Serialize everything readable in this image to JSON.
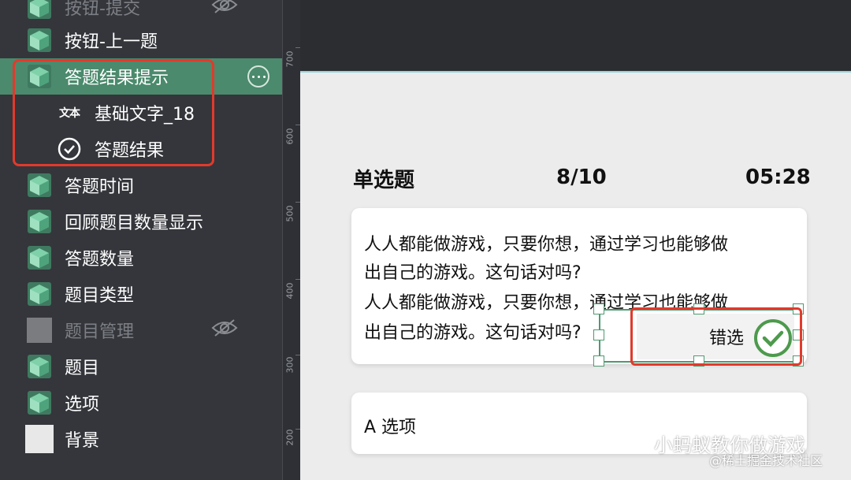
{
  "layers": [
    {
      "label": "按钮-提交",
      "icon": "cube-icon",
      "hidden": true
    },
    {
      "label": "按钮-上一题",
      "icon": "cube-icon",
      "hidden": false
    },
    {
      "label": "答题结果提示",
      "icon": "cube-icon",
      "hidden": false,
      "selected": true
    },
    {
      "label": "基础文字_18",
      "icon": "text-type-icon",
      "icon_text": "文本",
      "child": true
    },
    {
      "label": "答题结果",
      "icon": "check-circle-icon",
      "child": true
    },
    {
      "label": "答题时间",
      "icon": "cube-icon"
    },
    {
      "label": "回顾题目数量显示",
      "icon": "cube-icon"
    },
    {
      "label": "答题数量",
      "icon": "cube-icon"
    },
    {
      "label": "题目类型",
      "icon": "cube-icon"
    },
    {
      "label": "题目管理",
      "icon": "gray-square-icon",
      "hidden": true
    },
    {
      "label": "题目",
      "icon": "cube-icon"
    },
    {
      "label": "选项",
      "icon": "cube-icon"
    },
    {
      "label": "背景",
      "icon": "white-square-icon"
    }
  ],
  "ruler": {
    "labels": [
      "700",
      "600",
      "500",
      "400",
      "300",
      "200"
    ]
  },
  "quiz": {
    "type": "单选题",
    "progress": "8/10",
    "timer": "05:28",
    "question_lines": [
      "人人都能做游戏，只要你想，通过学习也能够做",
      "出自己的游戏。这句话对吗?",
      "人人都能做游戏，只要你想，通过学习也能够做",
      "出自己的游戏。这句话对吗?"
    ],
    "result_label": "错选",
    "option_a": "A  选项"
  },
  "watermark": {
    "channel": "小蚂蚁教你做游戏",
    "community": "@稀土掘金技术社区"
  },
  "colors": {
    "selected_row": "#4b8a6c",
    "highlight": "#e13a2c",
    "cube": "#5fb890",
    "check": "#4d9a4d"
  }
}
